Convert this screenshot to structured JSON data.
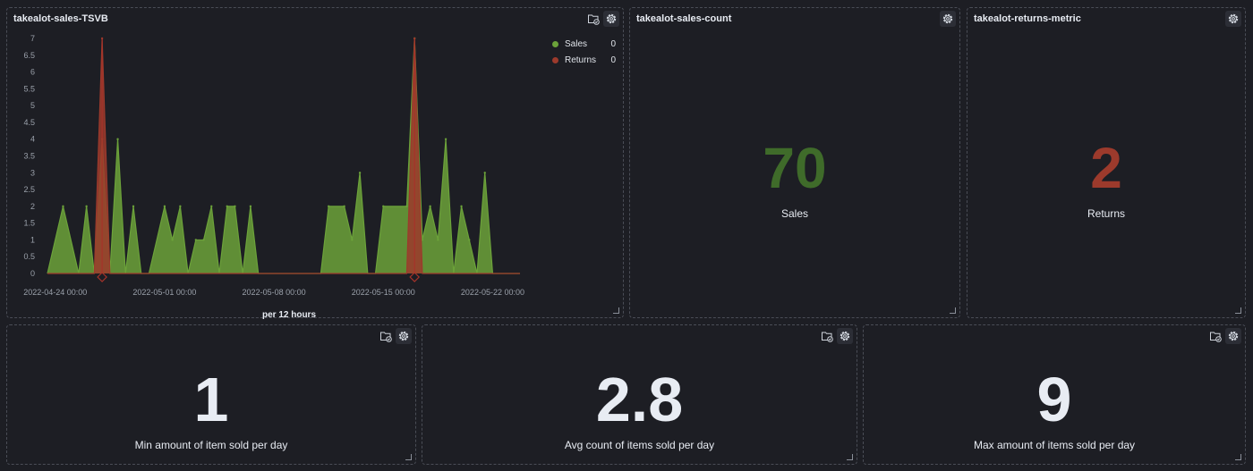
{
  "panels": {
    "tsvb": {
      "title": "takealot-sales-TSVB",
      "x_axis_title": "per 12 hours",
      "legend": [
        {
          "name": "Sales",
          "value": "0",
          "color": "#6ca23a"
        },
        {
          "name": "Returns",
          "value": "0",
          "color": "#9c3a2c"
        }
      ]
    },
    "sales_count": {
      "title": "takealot-sales-count",
      "value": "70",
      "label": "Sales",
      "color": "#3f6b2a"
    },
    "returns_metric": {
      "title": "takealot-returns-metric",
      "value": "2",
      "label": "Returns",
      "color": "#9c3a2c"
    },
    "min_metric": {
      "value": "1",
      "label": "Min amount of item sold per day"
    },
    "avg_metric": {
      "value": "2.8",
      "label": "Avg count of items sold per day"
    },
    "max_metric": {
      "value": "9",
      "label": "Max amount of items sold per day"
    }
  },
  "icons": {
    "inspect": "folder-check-icon",
    "settings": "gear-icon",
    "resize": "resize-handle-icon",
    "annotation": "diamond-marker-icon"
  },
  "chart_data": {
    "type": "area",
    "xlabel": "per 12 hours",
    "ylabel": "",
    "ylim": [
      0,
      7
    ],
    "yticks": [
      "0",
      "0.5",
      "1",
      "1.5",
      "2",
      "2.5",
      "3",
      "3.5",
      "4",
      "4.5",
      "5",
      "5.5",
      "6",
      "6.5",
      "7"
    ],
    "xticks": [
      {
        "t": 0,
        "label": "2022-04-24 00:00"
      },
      {
        "t": 14,
        "label": "2022-05-01 00:00"
      },
      {
        "t": 28,
        "label": "2022-05-08 00:00"
      },
      {
        "t": 42,
        "label": "2022-05-15 00:00"
      },
      {
        "t": 56,
        "label": "2022-05-22 00:00"
      }
    ],
    "x_start": -1,
    "x_end": 59.5,
    "grid": false,
    "legend": "top-right",
    "series": [
      {
        "name": "Sales",
        "color": "#6ca23a",
        "points": [
          [
            -1,
            0
          ],
          [
            1,
            2
          ],
          [
            3,
            0
          ],
          [
            4,
            2
          ],
          [
            5,
            0
          ],
          [
            6,
            4
          ],
          [
            7,
            0
          ],
          [
            8,
            4
          ],
          [
            9,
            0
          ],
          [
            10,
            2
          ],
          [
            11,
            0
          ],
          [
            12,
            0
          ],
          [
            14,
            2
          ],
          [
            15,
            1
          ],
          [
            16,
            2
          ],
          [
            17,
            0
          ],
          [
            18,
            1
          ],
          [
            19,
            1
          ],
          [
            20,
            2
          ],
          [
            21,
            0
          ],
          [
            22,
            2
          ],
          [
            23,
            2
          ],
          [
            24,
            0
          ],
          [
            25,
            2
          ],
          [
            26,
            0
          ],
          [
            29,
            0
          ],
          [
            34,
            0
          ],
          [
            35,
            2
          ],
          [
            37,
            2
          ],
          [
            38,
            1
          ],
          [
            39,
            3
          ],
          [
            40,
            0
          ],
          [
            41,
            0
          ],
          [
            42,
            2
          ],
          [
            45,
            2
          ],
          [
            46,
            7
          ],
          [
            47,
            1
          ],
          [
            48,
            2
          ],
          [
            49,
            1
          ],
          [
            50,
            4
          ],
          [
            51,
            0
          ],
          [
            52,
            2
          ],
          [
            53,
            1
          ],
          [
            54,
            0
          ],
          [
            55,
            3
          ],
          [
            56,
            0
          ],
          [
            59.5,
            0
          ]
        ]
      },
      {
        "name": "Returns",
        "color": "#9c3a2c",
        "points": [
          [
            -1,
            0
          ],
          [
            5,
            0
          ],
          [
            6,
            7
          ],
          [
            7,
            0
          ],
          [
            45,
            0
          ],
          [
            46,
            7
          ],
          [
            47,
            0
          ],
          [
            59.5,
            0
          ]
        ]
      }
    ],
    "annotations": [
      6,
      46
    ]
  }
}
